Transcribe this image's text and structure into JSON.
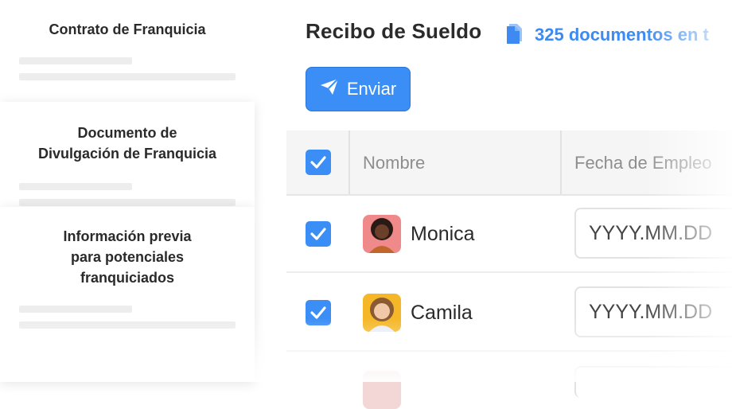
{
  "documents": [
    {
      "title": "Contrato de Franquicia"
    },
    {
      "title": "Documento de\nDivulgación de Franquicia"
    },
    {
      "title": "Información previa\npara potenciales\nfranquiciados"
    }
  ],
  "header": {
    "title": "Recibo de Sueldo",
    "docs_count": "325 documentos en t",
    "docs_icon": "document-stack-icon"
  },
  "actions": {
    "send_label": "Enviar",
    "send_icon": "paper-plane-icon"
  },
  "table": {
    "columns": [
      "Nombre",
      "Fecha de Empleo"
    ],
    "rows": [
      {
        "name": "Monica",
        "date_placeholder": "YYYY.MM.DD",
        "checked": true
      },
      {
        "name": "Camila",
        "date_placeholder": "YYYY.MM.DD",
        "checked": true
      }
    ]
  },
  "colors": {
    "accent": "#3a8ef6",
    "link": "#3d8bf2"
  }
}
